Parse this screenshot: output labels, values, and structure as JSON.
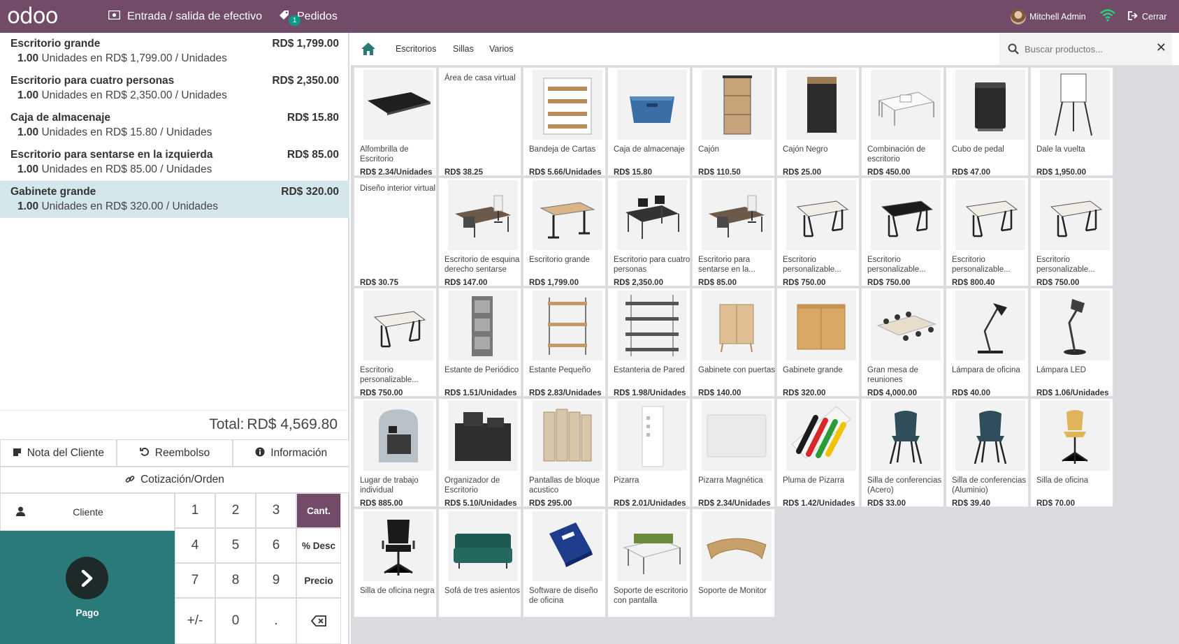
{
  "topbar": {
    "logo": "odoo",
    "cash_label": "Entrada / salida de efectivo",
    "orders_label": "Pedidos",
    "orders_badge": "1",
    "user_name": "Mitchell Admin",
    "close_label": "Cerrar",
    "color": "#714b67"
  },
  "order": {
    "lines": [
      {
        "name": "Escritorio grande",
        "qty": "1.00",
        "detail": "Unidades en RD$ 1,799.00 / Unidades",
        "price": "RD$ 1,799.00",
        "selected": false
      },
      {
        "name": "Escritorio para cuatro personas",
        "qty": "1.00",
        "detail": "Unidades en RD$ 2,350.00 / Unidades",
        "price": "RD$ 2,350.00",
        "selected": false
      },
      {
        "name": "Caja de almacenaje",
        "qty": "1.00",
        "detail": "Unidades en RD$ 15.80 / Unidades",
        "price": "RD$ 15.80",
        "selected": false
      },
      {
        "name": "Escritorio para sentarse en la izquierda",
        "qty": "1.00",
        "detail": "Unidades en RD$ 85.00 / Unidades",
        "price": "RD$ 85.00",
        "selected": false
      },
      {
        "name": "Gabinete grande",
        "qty": "1.00",
        "detail": "Unidades en RD$ 320.00 / Unidades",
        "price": "RD$ 320.00",
        "selected": true
      }
    ],
    "total_label": "Total:",
    "total_value": "RD$ 4,569.80"
  },
  "controls": {
    "customer_note": "Nota del Cliente",
    "refund": "Reembolso",
    "info": "Información",
    "quotation": "Cotización/Orden",
    "customer": "Cliente",
    "payment": "Pago"
  },
  "numpad": {
    "keys": [
      "1",
      "2",
      "3",
      "4",
      "5",
      "6",
      "7",
      "8",
      "9",
      "+/-",
      "0",
      "."
    ],
    "modes": [
      "Cant.",
      "% Desc",
      "Precio"
    ],
    "active_mode": "Cant.",
    "backspace": "⌫"
  },
  "categories": [
    "Escritorios",
    "Sillas",
    "Varios"
  ],
  "search": {
    "placeholder": "Buscar productos..."
  },
  "products": [
    {
      "name": "Alfombrilla de Escritorio",
      "price": "RD$ 2.34/Unidades",
      "img": "mat"
    },
    {
      "name": "Área de casa virtual",
      "price": "RD$ 38.25",
      "img": "none"
    },
    {
      "name": "Bandeja de Cartas",
      "price": "RD$ 5.66/Unidades",
      "img": "tray"
    },
    {
      "name": "Caja de almacenaje",
      "price": "RD$ 15.80",
      "img": "box"
    },
    {
      "name": "Cajón",
      "price": "RD$ 110.50",
      "img": "drawer"
    },
    {
      "name": "Cajón Negro",
      "price": "RD$ 25.00",
      "img": "drawer-black"
    },
    {
      "name": "Combinación de escritorio",
      "price": "RD$ 450.00",
      "img": "desk-combo"
    },
    {
      "name": "Cubo de pedal",
      "price": "RD$ 47.00",
      "img": "bin"
    },
    {
      "name": "Dale la vuelta",
      "price": "RD$ 1,950.00",
      "img": "flipchart"
    },
    {
      "name": "Diseño interior virtual",
      "price": "RD$ 30.75",
      "img": "none"
    },
    {
      "name": "Escritorio de esquina derecho sentarse",
      "price": "RD$ 147.00",
      "img": "office-desk"
    },
    {
      "name": "Escritorio grande",
      "price": "RD$ 1,799.00",
      "img": "standing-desk"
    },
    {
      "name": "Escritorio para cuatro personas",
      "price": "RD$ 2,350.00",
      "img": "quad-desk"
    },
    {
      "name": "Escritorio para sentarse en la...",
      "price": "RD$ 85.00",
      "img": "office-desk"
    },
    {
      "name": "Escritorio personalizable...",
      "price": "RD$ 750.00",
      "img": "table-white"
    },
    {
      "name": "Escritorio personalizable...",
      "price": "RD$ 750.00",
      "img": "table-black"
    },
    {
      "name": "Escritorio personalizable...",
      "price": "RD$ 800.40",
      "img": "table-white"
    },
    {
      "name": "Escritorio personalizable...",
      "price": "RD$ 750.00",
      "img": "table-white"
    },
    {
      "name": "Escritorio personalizable...",
      "price": "RD$ 750.00",
      "img": "table-white"
    },
    {
      "name": "Estante de Periódico",
      "price": "RD$ 1.51/Unidades",
      "img": "magazine-rack"
    },
    {
      "name": "Estante Pequeño",
      "price": "RD$ 2.83/Unidades",
      "img": "shelf"
    },
    {
      "name": "Estanteria de Pared",
      "price": "RD$ 1.98/Unidades",
      "img": "wall-shelf"
    },
    {
      "name": "Gabinete con puertas",
      "price": "RD$ 140.00",
      "img": "cabinet"
    },
    {
      "name": "Gabinete grande",
      "price": "RD$ 320.00",
      "img": "cabinet-large"
    },
    {
      "name": "Gran mesa de reuniones",
      "price": "RD$ 4,000.00",
      "img": "meeting-table"
    },
    {
      "name": "Lámpara de oficina",
      "price": "RD$ 40.00",
      "img": "lamp"
    },
    {
      "name": "Lámpara LED",
      "price": "RD$ 1.06/Unidades",
      "img": "lamp-led"
    },
    {
      "name": "Lugar de trabajo individual",
      "price": "RD$ 885.00",
      "img": "pod"
    },
    {
      "name": "Organizador de Escritorio",
      "price": "RD$ 5.10/Unidades",
      "img": "organizer"
    },
    {
      "name": "Pantallas de bloque acustico",
      "price": "RD$ 295.00",
      "img": "screens"
    },
    {
      "name": "Pizarra",
      "price": "RD$ 2.01/Unidades",
      "img": "board"
    },
    {
      "name": "Pizarra Magnética",
      "price": "RD$ 2.34/Unidades",
      "img": "board-magnetic"
    },
    {
      "name": "Pluma de Pizarra",
      "price": "RD$ 1.42/Unidades",
      "img": "markers"
    },
    {
      "name": "Silla de conferencias (Acero)",
      "price": "RD$ 33.00",
      "img": "chair-conf"
    },
    {
      "name": "Silla de conferencias (Aluminio)",
      "price": "RD$ 39.40",
      "img": "chair-conf"
    },
    {
      "name": "Silla de oficina",
      "price": "RD$ 70.00",
      "img": "chair-office"
    },
    {
      "name": "Silla de oficina negra",
      "price": "",
      "img": "chair-black"
    },
    {
      "name": "Sofá de tres asientos",
      "price": "",
      "img": "sofa"
    },
    {
      "name": "Software de diseño de oficina",
      "price": "",
      "img": "software"
    },
    {
      "name": "Soporte de escritorio con pantalla",
      "price": "",
      "img": "desk-screen"
    },
    {
      "name": "Soporte de Monitor",
      "price": "",
      "img": "monitor-stand"
    }
  ]
}
